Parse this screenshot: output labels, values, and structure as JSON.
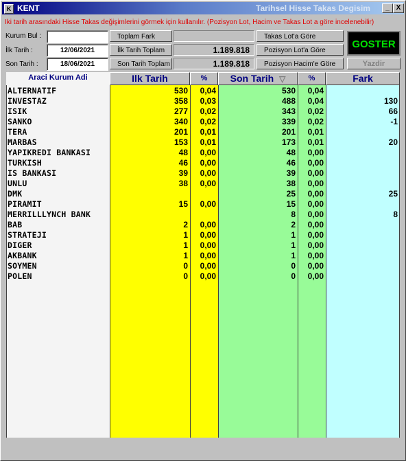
{
  "window": {
    "title": "KENT",
    "title_right": "Tarihsel Hisse Takas Degisim",
    "min_label": "_",
    "max_label": "□",
    "close_label": "X",
    "icon_label": "K"
  },
  "info_text": "İki tarih arasındaki Hisse Takas değişimlerini görmek için kullanılır. (Pozisyon Lot, Hacim ve Takas Lot a göre incelenebilir)",
  "form": {
    "kurum_bul_label": "Kurum Bul :",
    "kurum_bul_value": "",
    "ilk_tarih_label": "İlk Tarih     :",
    "ilk_tarih_value": "12/06/2021",
    "son_tarih_label": "Son Tarih    :",
    "son_tarih_value": "18/06/2021"
  },
  "summary": {
    "toplam_fark_label": "Toplam Fark",
    "toplam_fark_value": "",
    "ilk_toplam_label": "İlk Tarih Toplam",
    "ilk_toplam_value": "1.189.818",
    "son_toplam_label": "Son Tarih Toplam",
    "son_toplam_value": "1.189.818"
  },
  "options": {
    "takas_lot": "Takas Lot'a Göre",
    "pozisyon_lot": "Pozisyon Lot'a Göre",
    "pozisyon_hacim": "Pozisyon Hacim'e Göre"
  },
  "actions": {
    "goster": "GOSTER",
    "yazdir": "Yazdir"
  },
  "table": {
    "headers": {
      "name": "Araci Kurum Adi",
      "ilk": "Ilk Tarih",
      "ilk_pct": "%",
      "son": "Son Tarih",
      "sort_icon": "▽",
      "son_pct": "%",
      "fark": "Fark"
    },
    "colors": {
      "ilk": "#ffff00",
      "son": "#98fb98",
      "fark": "#c0ffff",
      "name": "#f4f4f4"
    },
    "rows": [
      {
        "name": "ALTERNATIF",
        "ilk": "530",
        "ilk_pct": "0,04",
        "son": "530",
        "son_pct": "0,04",
        "fark": ""
      },
      {
        "name": "INVESTAZ",
        "ilk": "358",
        "ilk_pct": "0,03",
        "son": "488",
        "son_pct": "0,04",
        "fark": "130"
      },
      {
        "name": "ISIK",
        "ilk": "277",
        "ilk_pct": "0,02",
        "son": "343",
        "son_pct": "0,02",
        "fark": "66"
      },
      {
        "name": "SANKO",
        "ilk": "340",
        "ilk_pct": "0,02",
        "son": "339",
        "son_pct": "0,02",
        "fark": "-1"
      },
      {
        "name": "TERA",
        "ilk": "201",
        "ilk_pct": "0,01",
        "son": "201",
        "son_pct": "0,01",
        "fark": ""
      },
      {
        "name": "MARBAS",
        "ilk": "153",
        "ilk_pct": "0,01",
        "son": "173",
        "son_pct": "0,01",
        "fark": "20"
      },
      {
        "name": "YAPIKREDI BANKASI",
        "ilk": "48",
        "ilk_pct": "0,00",
        "son": "48",
        "son_pct": "0,00",
        "fark": ""
      },
      {
        "name": "TURKISH",
        "ilk": "46",
        "ilk_pct": "0,00",
        "son": "46",
        "son_pct": "0,00",
        "fark": ""
      },
      {
        "name": "IS BANKASI",
        "ilk": "39",
        "ilk_pct": "0,00",
        "son": "39",
        "son_pct": "0,00",
        "fark": ""
      },
      {
        "name": "UNLU",
        "ilk": "38",
        "ilk_pct": "0,00",
        "son": "38",
        "son_pct": "0,00",
        "fark": ""
      },
      {
        "name": "DMK",
        "ilk": "",
        "ilk_pct": "",
        "son": "25",
        "son_pct": "0,00",
        "fark": "25"
      },
      {
        "name": "PIRAMIT",
        "ilk": "15",
        "ilk_pct": "0,00",
        "son": "15",
        "son_pct": "0,00",
        "fark": ""
      },
      {
        "name": "MERRILLLYNCH BANK",
        "ilk": "",
        "ilk_pct": "",
        "son": "8",
        "son_pct": "0,00",
        "fark": "8"
      },
      {
        "name": "BAB",
        "ilk": "2",
        "ilk_pct": "0,00",
        "son": "2",
        "son_pct": "0,00",
        "fark": ""
      },
      {
        "name": "STRATEJI",
        "ilk": "1",
        "ilk_pct": "0,00",
        "son": "1",
        "son_pct": "0,00",
        "fark": ""
      },
      {
        "name": "DIGER",
        "ilk": "1",
        "ilk_pct": "0,00",
        "son": "1",
        "son_pct": "0,00",
        "fark": ""
      },
      {
        "name": "AKBANK",
        "ilk": "1",
        "ilk_pct": "0,00",
        "son": "1",
        "son_pct": "0,00",
        "fark": ""
      },
      {
        "name": "SOYMEN",
        "ilk": "0",
        "ilk_pct": "0,00",
        "son": "0",
        "son_pct": "0,00",
        "fark": ""
      },
      {
        "name": "POLEN",
        "ilk": "0",
        "ilk_pct": "0,00",
        "son": "0",
        "son_pct": "0,00",
        "fark": ""
      }
    ]
  }
}
